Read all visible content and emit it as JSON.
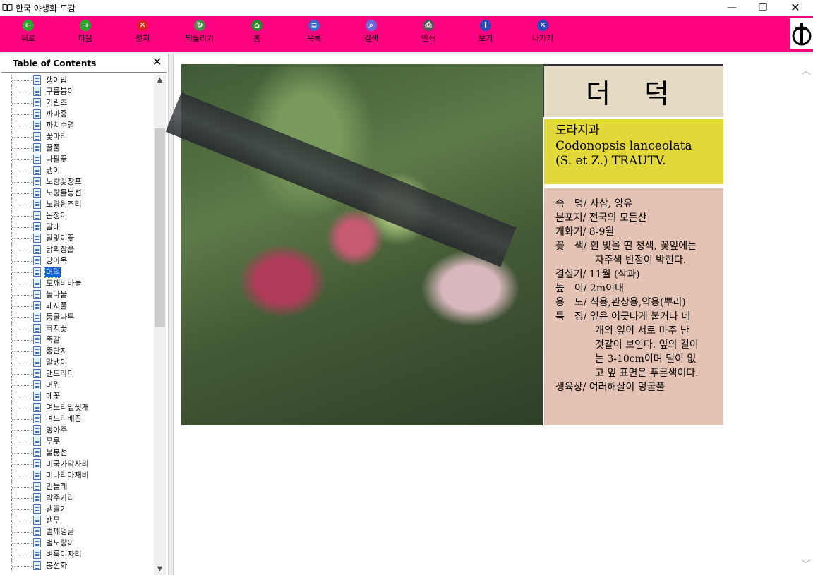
{
  "window": {
    "title": "한국 야생화 도감",
    "minimize": "—",
    "maximize": "❐",
    "close": "✕"
  },
  "toolbar": {
    "buttons": [
      {
        "label": "뒤로",
        "icon": "back-arrow-icon",
        "color": "#2aa82a",
        "glyph": "←"
      },
      {
        "label": "다음",
        "icon": "forward-arrow-icon",
        "color": "#2aa82a",
        "glyph": "→"
      },
      {
        "label": "정지",
        "icon": "stop-icon",
        "color": "#e02020",
        "glyph": "✕"
      },
      {
        "label": "되돌리기",
        "icon": "refresh-icon",
        "color": "#4a8a4a",
        "glyph": "↻"
      },
      {
        "label": "홈",
        "icon": "home-icon",
        "color": "#2a8a2a",
        "glyph": "⌂"
      },
      {
        "label": "목록",
        "icon": "list-document-icon",
        "color": "#3a6ac8",
        "glyph": "≡"
      },
      {
        "label": "검색",
        "icon": "search-icon",
        "color": "#6a6ad8",
        "glyph": "⌕"
      },
      {
        "label": "인쇄",
        "icon": "print-icon",
        "color": "#555555",
        "glyph": "⎙"
      },
      {
        "label": "보기",
        "icon": "info-icon",
        "color": "#2a4ab8",
        "glyph": "i"
      },
      {
        "label": "나가기",
        "icon": "exit-icon",
        "color": "#2a4ab8",
        "glyph": "✕"
      }
    ],
    "background": "#ff0080"
  },
  "toc": {
    "title": "Table of Contents",
    "close": "✕",
    "selected": "더덕",
    "items": [
      "괭이밥",
      "구름붕이",
      "기린초",
      "까마중",
      "까치수염",
      "꽃마리",
      "꿀풀",
      "나팔꽃",
      "냉이",
      "노랑꽃창포",
      "노랑물봉선",
      "노랑원추리",
      "논정이",
      "달래",
      "달맞이꽃",
      "닭의장풀",
      "당아욱",
      "더덕",
      "도깨비바늘",
      "돌나물",
      "돼지풀",
      "등굴나무",
      "딱지꽃",
      "뚝갈",
      "뚱단지",
      "말냉이",
      "맨드라미",
      "머위",
      "메꽃",
      "며느리밑씻개",
      "며느리배꼽",
      "명아주",
      "무릇",
      "물봉선",
      "미국가막사리",
      "미나리아재비",
      "민들레",
      "박주가리",
      "뱀딸기",
      "뱀무",
      "벌깨덩굴",
      "별노랑이",
      "벼룩이자리",
      "봉선화"
    ]
  },
  "plant": {
    "name": "더 덕",
    "family": "도라지과",
    "scientific_line1": "Codonopsis lanceolata",
    "scientific_line2": "(S. et Z.) TRAUTV.",
    "rows": [
      "속　명/ 사삼, 양유",
      "분포지/ 전국의 모든산",
      "개화기/ 8-9월",
      "꽃　색/ 흰 빛을 띤 청색, 꽃잎에는",
      "　　　　자주색 반점이 박힌다.",
      "결실기/ 11월 (삭과)",
      "높　이/ 2m이내",
      "용　도/ 식용,관상용,약용(뿌리)",
      "특　징/ 잎은 어긋나게 붙거나 네",
      "　　　　개의 잎이 서로 마주 난",
      "　　　　것같이 보인다. 잎의 길이",
      "　　　　는 3-10cm이며 털이 없",
      "　　　　고 잎 표면은 푸른색이다.",
      "생육상/ 여러해살이 덩굴풀"
    ],
    "colors": {
      "header": "#e6dcc5",
      "family_band": "#e3d83a",
      "info_band": "#e4c3b5"
    }
  },
  "scroll": {
    "up": "︿",
    "down": "﹀"
  }
}
